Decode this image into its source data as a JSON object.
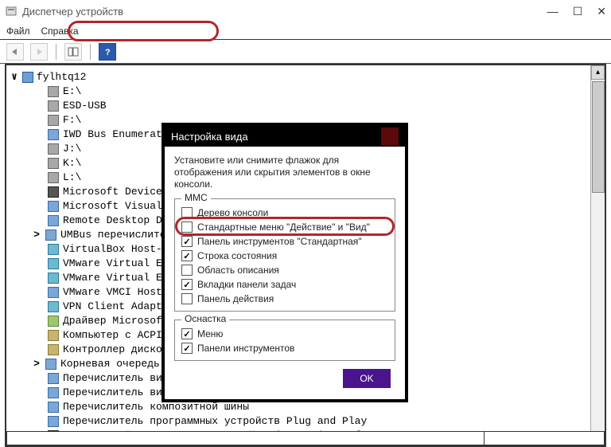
{
  "window": {
    "title": "Диспетчер устройств"
  },
  "menus": {
    "file": "Файл",
    "help": "Справка"
  },
  "tree": {
    "root": "fylhtq12",
    "items": [
      {
        "label": "E:\\",
        "icon": "drive"
      },
      {
        "label": "ESD-USB",
        "icon": "drive"
      },
      {
        "label": "F:\\",
        "icon": "drive"
      },
      {
        "label": "IWD Bus Enumerator",
        "icon": "folder"
      },
      {
        "label": "J:\\",
        "icon": "drive"
      },
      {
        "label": "K:\\",
        "icon": "drive"
      },
      {
        "label": "L:\\",
        "icon": "drive"
      },
      {
        "label": "Microsoft Device A",
        "icon": "dark"
      },
      {
        "label": "Microsoft Visual S",
        "icon": "folder"
      },
      {
        "label": "Remote Desktop Dev",
        "icon": "folder"
      },
      {
        "label": "UMBus перечислител",
        "icon": "folder",
        "expandable": true
      },
      {
        "label": "VirtualBox Host-On",
        "icon": "net"
      },
      {
        "label": "VMware Virtual Eth",
        "icon": "net"
      },
      {
        "label": "VMware Virtual Eth",
        "icon": "net"
      },
      {
        "label": "VMware VMCI Host D",
        "icon": "folder"
      },
      {
        "label": "VPN Client Adapter",
        "icon": "net"
      },
      {
        "label": "Драйвер Microsoft",
        "icon": "dev"
      },
      {
        "label": "Компьютер с ACPI н",
        "icon": "other"
      },
      {
        "label": "Контроллер дисково",
        "icon": "other"
      },
      {
        "label": "Корневая очередь п",
        "icon": "folder",
        "expandable": true
      },
      {
        "label": "Перечислитель виртуальных дисков (Майкрософт)",
        "icon": "folder"
      },
      {
        "label": "Перечислитель виртуальных сетевых адаптеров NDIS",
        "icon": "folder"
      },
      {
        "label": "Перечислитель композитной шины",
        "icon": "folder"
      },
      {
        "label": "Перечислитель программных устройств Plug and Play",
        "icon": "folder"
      },
      {
        "label": "Программный синтезатор звуковой таблицы Microsoft",
        "icon": "dark"
      }
    ]
  },
  "dialog": {
    "title": "Настройка вида",
    "description": "Установите или снимите флажок для отображения или скрытия элементов в окне консоли.",
    "group_mmc": {
      "legend": "MMC",
      "options": [
        {
          "label": "Дерево консоли",
          "checked": false
        },
        {
          "label": "Стандартные меню \"Действие\" и \"Вид\"",
          "checked": false
        },
        {
          "label": "Панель инструментов \"Стандартная\"",
          "checked": true
        },
        {
          "label": "Строка состояния",
          "checked": true
        },
        {
          "label": "Область описания",
          "checked": false
        },
        {
          "label": "Вкладки панели задач",
          "checked": true
        },
        {
          "label": "Панель действия",
          "checked": false
        }
      ]
    },
    "group_snapin": {
      "legend": "Оснастка",
      "options": [
        {
          "label": "Меню",
          "checked": true
        },
        {
          "label": "Панели инструментов",
          "checked": true
        }
      ]
    },
    "ok": "OK"
  }
}
